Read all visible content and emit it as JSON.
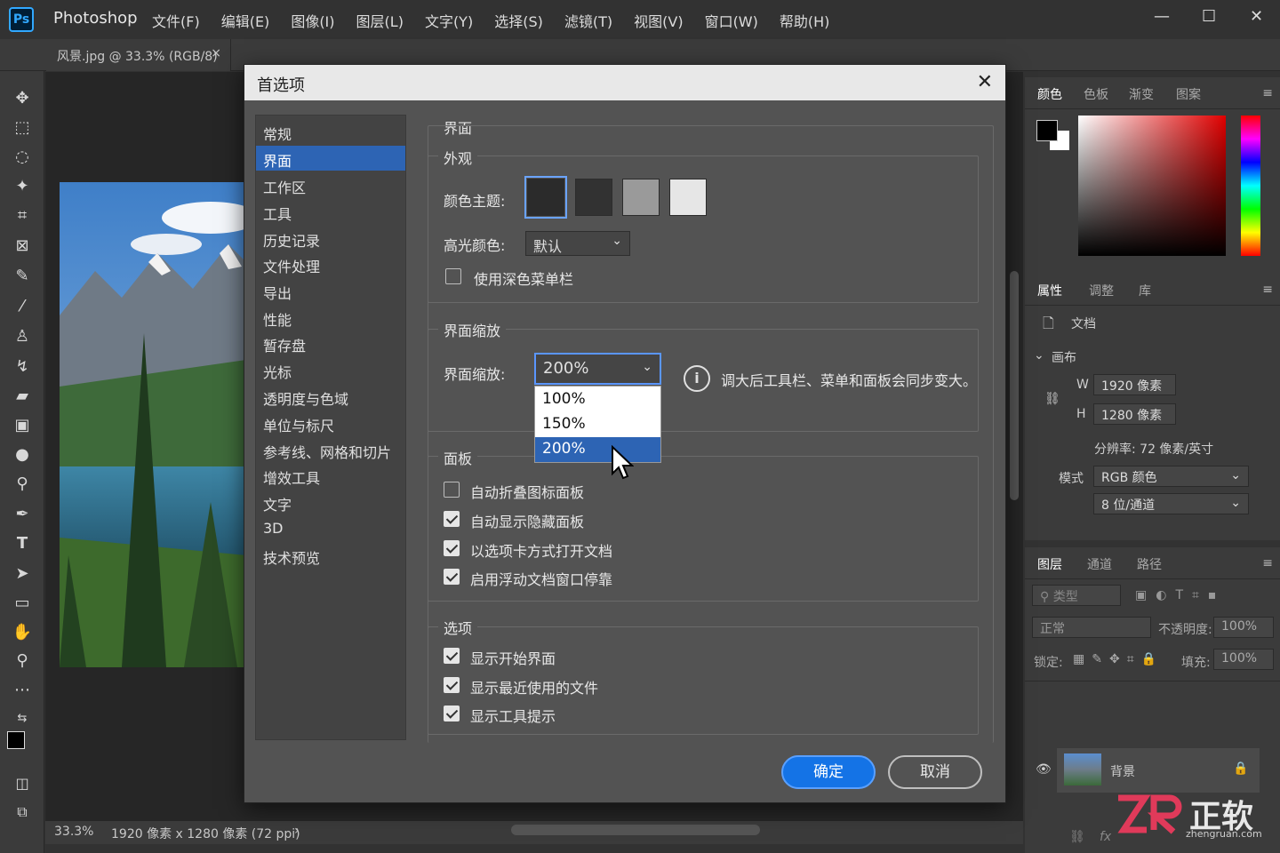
{
  "app": {
    "logo": "Ps",
    "name": "Photoshop",
    "menu": [
      "文件(F)",
      "编辑(E)",
      "图像(I)",
      "图层(L)",
      "文字(Y)",
      "选择(S)",
      "滤镜(T)",
      "视图(V)",
      "窗口(W)",
      "帮助(H)"
    ]
  },
  "document_tab": {
    "title": "风景.jpg @ 33.3% (RGB/8)",
    "close": "×"
  },
  "status": {
    "zoom": "33.3%",
    "info": "1920 像素 x 1280 像素 (72 ppi)"
  },
  "dialog": {
    "title": "首选项",
    "nav": [
      "常规",
      "界面",
      "工作区",
      "工具",
      "历史记录",
      "文件处理",
      "导出",
      "性能",
      "暂存盘",
      "光标",
      "透明度与色域",
      "单位与标尺",
      "参考线、网格和切片",
      "增效工具",
      "文字",
      "3D",
      "技术预览"
    ],
    "selected_nav": "界面",
    "section_title": "界面",
    "appearance": {
      "title": "外观",
      "color_theme_label": "颜色主题:",
      "themes": [
        "#2b2b2b",
        "#323232",
        "#9a9a9a",
        "#e6e6e6"
      ],
      "highlight_label": "高光颜色:",
      "highlight_value": "默认",
      "dark_menu_label": "使用深色菜单栏",
      "dark_menu_checked": false
    },
    "scaling": {
      "title": "界面缩放",
      "label": "界面缩放:",
      "value": "200%",
      "options": [
        "100%",
        "150%",
        "200%"
      ],
      "info": "调大后工具栏、菜单和面板会同步变大。"
    },
    "panels": {
      "title": "面板",
      "items": [
        {
          "label": "自动折叠图标面板",
          "checked": false
        },
        {
          "label": "自动显示隐藏面板",
          "checked": true
        },
        {
          "label": "以选项卡方式打开文档",
          "checked": true
        },
        {
          "label": "启用浮动文档窗口停靠",
          "checked": true
        }
      ]
    },
    "options": {
      "title": "选项",
      "items": [
        {
          "label": "显示开始界面",
          "checked": true
        },
        {
          "label": "显示最近使用的文件",
          "checked": true
        },
        {
          "label": "显示工具提示",
          "checked": true
        }
      ]
    },
    "ok_label": "确定",
    "cancel_label": "取消"
  },
  "color_panel": {
    "tabs": [
      "颜色",
      "色板",
      "渐变",
      "图案"
    ]
  },
  "properties_panel": {
    "tabs": [
      "属性",
      "调整",
      "库"
    ],
    "doc_label": "文档",
    "canvas_label": "画布",
    "w_label": "W",
    "w_value": "1920 像素",
    "h_label": "H",
    "h_value": "1280 像素",
    "resolution": "分辨率: 72 像素/英寸",
    "mode_label": "模式",
    "mode_value": "RGB 颜色",
    "depth_value": "8 位/通道"
  },
  "layers_panel": {
    "tabs": [
      "图层",
      "通道",
      "路径"
    ],
    "search_placeholder": "类型",
    "blend_mode": "正常",
    "opacity_label": "不透明度:",
    "opacity_value": "100%",
    "lock_label": "锁定:",
    "fill_label": "填充:",
    "fill_value": "100%",
    "layer_name": "背景"
  },
  "watermark": {
    "brand": "正软",
    "url": "zhengruan.com"
  }
}
